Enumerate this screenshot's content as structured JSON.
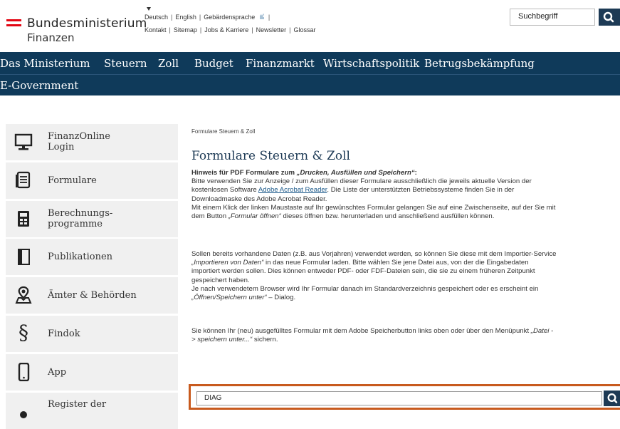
{
  "header": {
    "logo_title": "Bundesministerium",
    "logo_subtitle": "Finanzen",
    "brand_color": "#e30613",
    "util_links_row1": [
      "Deutsch",
      "English",
      "Gebärdensprache"
    ],
    "util_links_row2": [
      "Kontakt",
      "Sitemap",
      "Jobs & Karriere",
      "Newsletter",
      "Glossar"
    ],
    "search_placeholder": "Suchbegriff"
  },
  "nav": {
    "items": [
      "Das Ministerium",
      "Steuern",
      "Zoll",
      "Budget",
      "Finanzmarkt",
      "Wirtschaftspolitik",
      "Betrugsbekämpfung"
    ],
    "second_row": "E-Government",
    "color": "#0f3a5a"
  },
  "sidebar": {
    "items": [
      {
        "label": "FinanzOnline\nLogin",
        "icon": "monitor-icon"
      },
      {
        "label": "Formulare",
        "icon": "document-icon"
      },
      {
        "label": "Berechnungs-\nprogramme",
        "icon": "calculator-icon"
      },
      {
        "label": "Publikationen",
        "icon": "book-icon"
      },
      {
        "label": "Ämter & Behörden",
        "icon": "location-person-icon"
      },
      {
        "label": "Findok",
        "icon": "paragraph-icon"
      },
      {
        "label": "App",
        "icon": "smartphone-icon"
      },
      {
        "label": "Register der",
        "icon": "register-icon"
      }
    ]
  },
  "main": {
    "breadcrumb": "Formulare Steuern & Zoll",
    "title": "Formulare Steuern & Zoll",
    "hint_bold": "Hinweis für PDF Formulare zum ",
    "hint_bold_italic": "„Drucken, Ausfüllen und Speichern“",
    "hint_colon": ":",
    "p1_line2": "Bitte verwenden Sie zur Anzeige / zum Ausfüllen dieser Formulare ausschließlich die jeweils aktuelle Version der",
    "p1_line3a": "kostenlosen Software ",
    "p1_link": "Adobe Acrobat Reader",
    "p1_line3b": ". Die Liste der unterstützten Betriebssysteme finden Sie in der",
    "p1_line4": "Downloadmaske des Adobe Acrobat Reader.",
    "p1_line5": "Mit einem Klick der linken Maustaste auf Ihr gewünschtes Formular gelangen Sie auf eine Zwischenseite, auf der Sie mit",
    "p1_line6a": "dem Button ",
    "p1_line6b": "„Formular öffnen“",
    "p1_line6c": " dieses öffnen bzw. herunterladen und anschließend ausfüllen können.",
    "p2_line1": "Sollen bereits vorhandene Daten (z.B. aus Vorjahren) verwendet werden, so können Sie diese mit dem Importier-Service",
    "p2_line2a": "„Importieren von Daten“",
    "p2_line2b": " in das neue Formular laden. Bitte wählen Sie jene Datei aus, von der die Eingabedaten",
    "p2_line3": "importiert werden sollen. Dies können entweder PDF- oder FDF-Dateien sein, die sie zu einem früheren Zeitpunkt",
    "p2_line4": "gespeichert haben.",
    "p2_line5": "Je nach verwendetem Browser wird Ihr Formular danach im Standardverzeichnis gespeichert oder es erscheint ein",
    "p2_line6a": "„Öffnen/Speichern unter“",
    "p2_line6b": " – Dialog.",
    "p3_line1a": "Sie können Ihr (neu) ausgefülltes Formular mit dem Adobe Speicherbutton links oben oder über den Menüpunkt ",
    "p3_line1b": "„Datei -",
    "p3_line2a": "> speichern unter...“",
    "p3_line2b": " sichern.",
    "form_search_value": "DIAG",
    "highlight_color": "#c85a1e"
  }
}
